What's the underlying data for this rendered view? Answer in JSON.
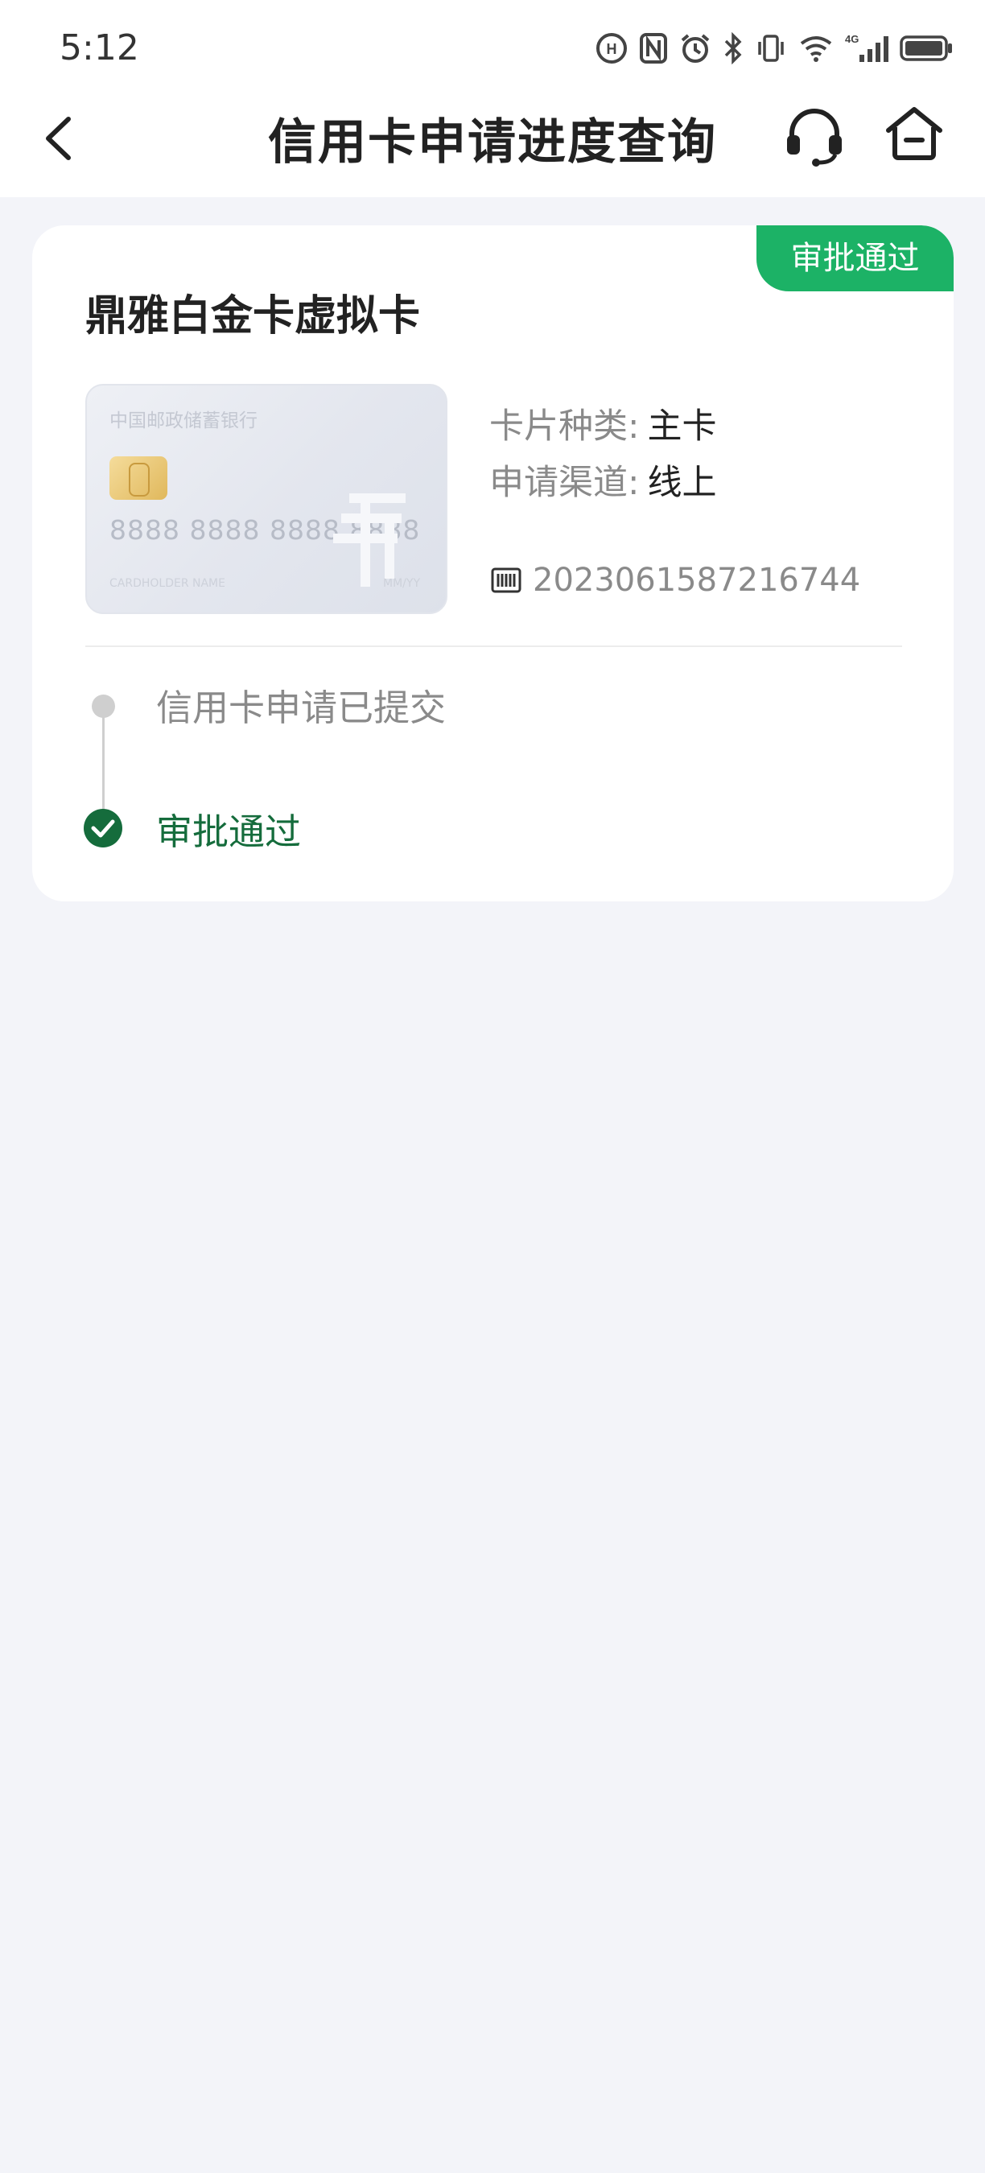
{
  "status_bar": {
    "time": "5:12",
    "icons": [
      "hd-icon",
      "nfc-icon",
      "alarm-icon",
      "bluetooth-icon",
      "vibrate-icon",
      "wifi-icon",
      "signal-4g-icon",
      "battery-icon"
    ]
  },
  "header": {
    "title": "信用卡申请进度查询",
    "back_icon": "chevron-left-icon",
    "service_icon": "headset-icon",
    "home_icon": "home-icon"
  },
  "application": {
    "status_badge": "审批通过",
    "product_name": "鼎雅白金卡虚拟卡",
    "card_image": {
      "bank_name": "中国邮政储蓄银行",
      "card_number": "8888 8888 8888 8888",
      "holder": "CARDHOLDER NAME",
      "expiry": "MM/YY"
    },
    "card_type_label": "卡片种类:",
    "card_type_value": "主卡",
    "channel_label": "申请渠道:",
    "channel_value": "线上",
    "application_number": "2023061587216744",
    "barcode_icon": "barcode-icon"
  },
  "timeline": {
    "steps": [
      {
        "label": "信用卡申请已提交",
        "state": "done"
      },
      {
        "label": "审批通过",
        "state": "current"
      }
    ]
  },
  "colors": {
    "accent_green": "#1cb266",
    "dark_green": "#156c3c",
    "page_bg": "#f3f4f9"
  }
}
